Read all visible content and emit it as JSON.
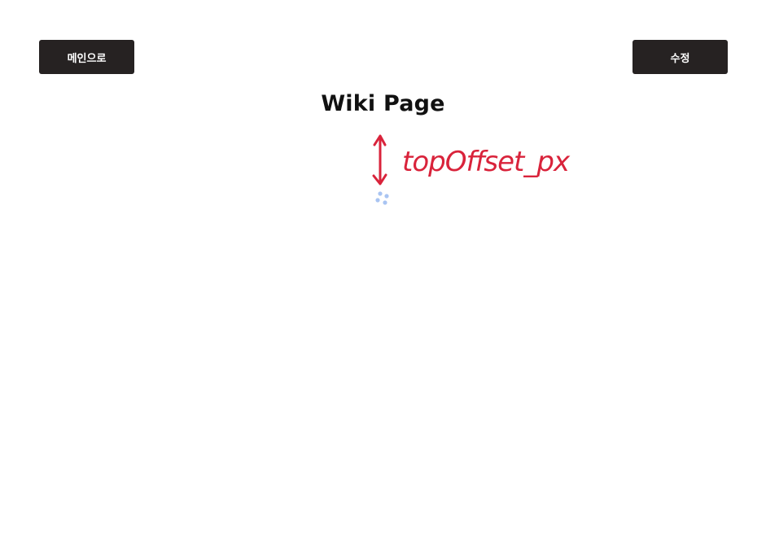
{
  "header": {
    "main_button_label": "메인으로",
    "edit_button_label": "수정"
  },
  "page": {
    "title": "Wiki Page"
  },
  "annotation": {
    "text": "topOffset_px",
    "color": "#d9233b"
  },
  "loading": {
    "icon": "loading-spinner-icon",
    "color": "#a9c4f2"
  },
  "colors": {
    "button_bg": "#262222",
    "button_text": "#ffffff",
    "background": "#ffffff"
  }
}
